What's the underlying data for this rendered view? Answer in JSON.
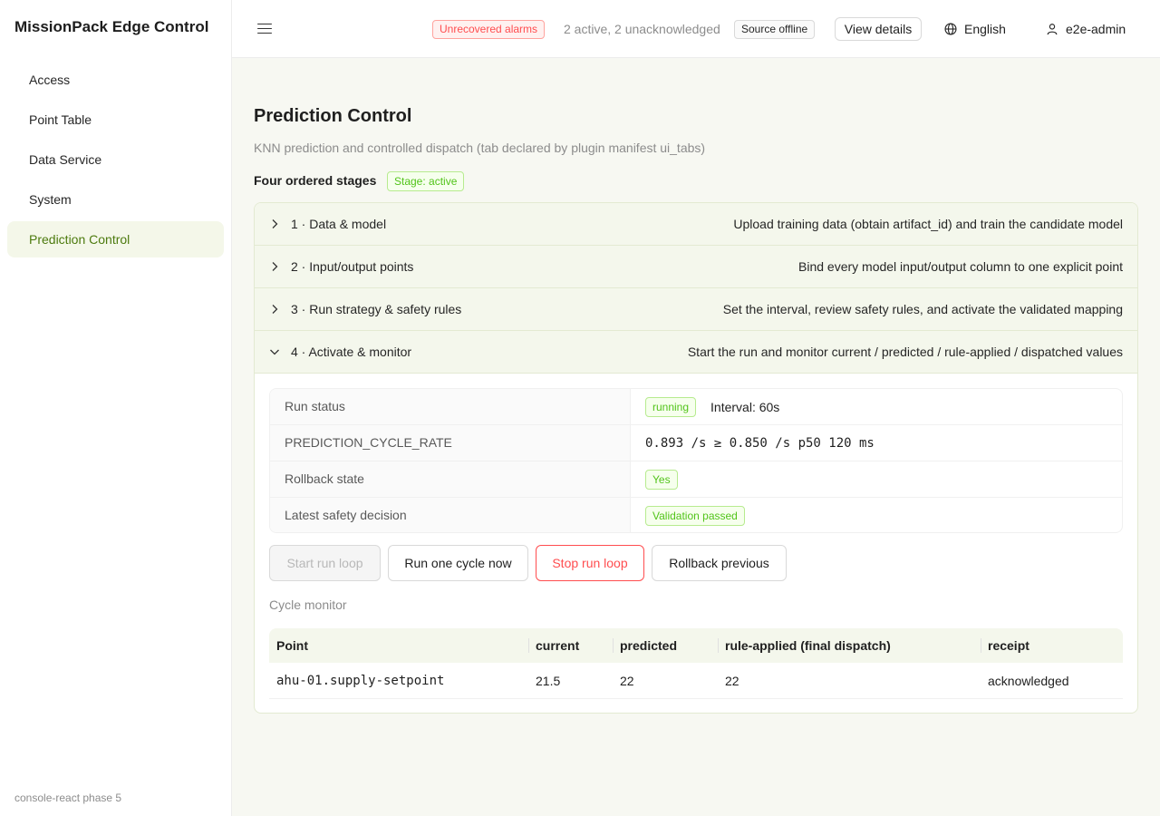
{
  "app": {
    "title": "MissionPack Edge Control",
    "footer": "console-react phase 5"
  },
  "sidebar": {
    "items": [
      {
        "label": "Access"
      },
      {
        "label": "Point Table"
      },
      {
        "label": "Data Service"
      },
      {
        "label": "System"
      },
      {
        "label": "Prediction Control",
        "active": true
      }
    ]
  },
  "header": {
    "alarm_tag": "Unrecovered alarms",
    "alarm_summary": "2 active, 2 unacknowledged",
    "source_tag": "Source offline",
    "view_details": "View details",
    "language": "English",
    "user": "e2e-admin"
  },
  "page": {
    "title": "Prediction Control",
    "subtitle": "KNN prediction and controlled dispatch (tab declared by plugin manifest ui_tabs)",
    "stages_title": "Four ordered stages",
    "stage_tag": "Stage: active"
  },
  "stages": [
    {
      "title": "1 · Data & model",
      "desc": "Upload training data (obtain artifact_id) and train the candidate model",
      "expanded": false
    },
    {
      "title": "2 · Input/output points",
      "desc": "Bind every model input/output column to one explicit point",
      "expanded": false
    },
    {
      "title": "3 · Run strategy & safety rules",
      "desc": "Set the interval, review safety rules, and activate the validated mapping",
      "expanded": false
    },
    {
      "title": "4 · Activate & monitor",
      "desc": "Start the run and monitor current / predicted / rule-applied / dispatched values",
      "expanded": true
    }
  ],
  "run": {
    "status_label": "Run status",
    "status_value": "running",
    "interval": "Interval: 60s",
    "rate_label": "PREDICTION_CYCLE_RATE",
    "rate_value": "0.893 /s ≥ 0.850 /s p50 120 ms",
    "rollback_label": "Rollback state",
    "rollback_value": "Yes",
    "safety_label": "Latest safety decision",
    "safety_value": "Validation passed"
  },
  "actions": {
    "start": "Start run loop",
    "run_once": "Run one cycle now",
    "stop": "Stop run loop",
    "rollback": "Rollback previous"
  },
  "monitor": {
    "title": "Cycle monitor",
    "columns": [
      "Point",
      "current",
      "predicted",
      "rule-applied (final dispatch)",
      "receipt"
    ],
    "rows": [
      [
        "ahu-01.supply-setpoint",
        "21.5",
        "22",
        "22",
        "acknowledged"
      ]
    ]
  },
  "colors": {
    "accent": "#4c7a0e",
    "danger": "#ff4d4f",
    "success": "#52c41a",
    "panel_bg": "#f4f7ec"
  },
  "icons": [
    "menu-icon",
    "globe-icon",
    "user-icon",
    "chevron-right-icon",
    "chevron-down-icon"
  ]
}
